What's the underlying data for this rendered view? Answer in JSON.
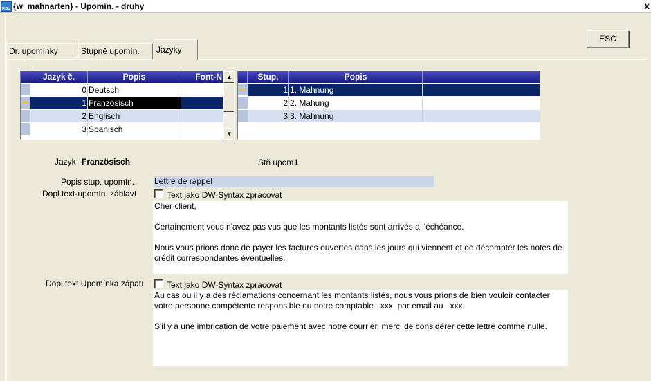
{
  "window": {
    "title": "{w_mahnarten} - Upomín. - druhy",
    "icon_name": "app-icon",
    "icon_text": "FIBU",
    "close_label": "x"
  },
  "esc_button": "ESC",
  "tabs": [
    {
      "label": "Dr. upomínky"
    },
    {
      "label": "Stupně upomín."
    },
    {
      "label": "Jazyky",
      "active": true
    }
  ],
  "languages_grid": {
    "columns": [
      "Jazyk č.",
      "Popis",
      "Font-N"
    ],
    "rows": [
      {
        "num": "0",
        "desc": "Deutsch"
      },
      {
        "num": "1",
        "desc": "Französisch",
        "selected": true
      },
      {
        "num": "2",
        "desc": "Englisch"
      },
      {
        "num": "3",
        "desc": "Spanisch"
      }
    ],
    "scroll_up": "▲",
    "scroll_down": "▼"
  },
  "levels_grid": {
    "columns": [
      "Stup.",
      "Popis",
      ""
    ],
    "rows": [
      {
        "num": "1",
        "desc": "1. Mahnung",
        "selected": true
      },
      {
        "num": "2",
        "desc": "2. Mahung"
      },
      {
        "num": "3",
        "desc": "3. Mahnung"
      }
    ]
  },
  "details": {
    "language_label": "Jazyk",
    "language_value": "Französisch",
    "level_label": "Stň upom.",
    "level_value": "1",
    "level_desc_label": "Popis stup. upomín.",
    "level_desc_value": "Lettre de rappel",
    "header_text_label": "Dopl.text-upomín. záhlaví",
    "header_checkbox_label": "Text jako DW-Syntax zpracovat",
    "header_text": "Cher client,\n\nCertainement vous n'avez pas vus que les montants listés sont arrivés a l'échéance.\n\nNous vous prions donc de payer les factures ouvertes dans les jours qui viennent et de décompter les notes de crédit correspondantes éventuelles.",
    "footer_text_label": "Dopl.text Upomínka zápatí",
    "footer_checkbox_label": "Text jako DW-Syntax zpracovat",
    "footer_text": "Au cas ou il y a des réclamations concernant les montants listés, nous vous prions de bien vouloir contacter votre personne compétente responsible ou notre comptable   xxx  par email au   xxx.\n\nS'il y a une imbrication de votre paiement avec notre courrier, merci de considérer cette lettre comme nulle."
  },
  "colors": {
    "header_gradient_top": "#4a4dc0",
    "header_gradient_bottom": "#181a85",
    "selected_row": "#0a2468",
    "alt_row": "#d6dff1",
    "field_bg": "#c9d5ea",
    "window_bg": "#ece9d8"
  }
}
